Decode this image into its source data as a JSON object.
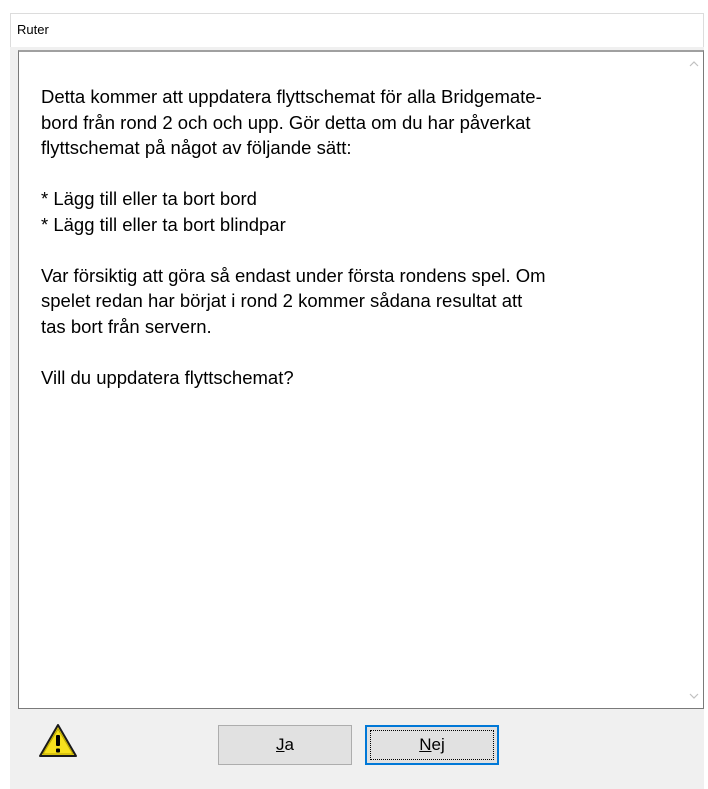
{
  "window": {
    "title": "Ruter"
  },
  "message": {
    "text": "Detta kommer att uppdatera flyttschemat för alla Bridgemate-\nbord från rond 2 och och upp. Gör detta om du har påverkat\nflyttschemat på något av följande sätt:\n\n* Lägg till eller ta bort bord\n* Lägg till eller ta bort blindpar\n\nVar försiktig att göra så endast under första rondens spel. Om\nspelet redan har börjat i rond 2 kommer sådana resultat att\ntas bort från servern.\n\nVill du uppdatera flyttschemat?"
  },
  "scrollbar": {
    "up_icon": "chevron-up-icon",
    "down_icon": "chevron-down-icon"
  },
  "icon": {
    "name": "warning-icon",
    "color": "#f7e11d"
  },
  "buttons": {
    "yes": {
      "accel": "J",
      "rest": "a"
    },
    "no": {
      "accel": "N",
      "rest": "ej"
    }
  }
}
